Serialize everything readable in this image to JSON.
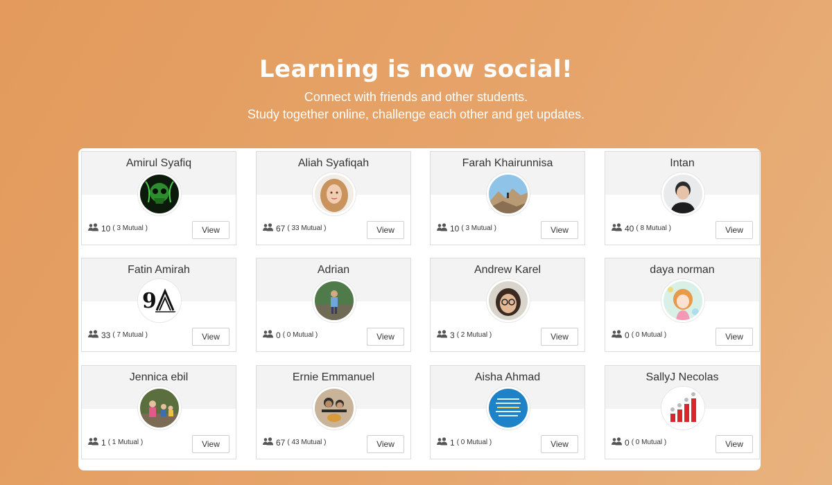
{
  "hero": {
    "title": "Learning is now social!",
    "line1": "Connect with friends and other students.",
    "line2": "Study together online, challenge each other and get updates."
  },
  "view_label": "View",
  "friends": [
    {
      "name": "Amirul Syafiq",
      "count": "10",
      "mutual": "( 3 Mutual )",
      "avatar": "green-skull-avatar"
    },
    {
      "name": "Aliah Syafiqah",
      "count": "67",
      "mutual": "( 33 Mutual )",
      "avatar": "blonde-woman-avatar"
    },
    {
      "name": "Farah Khairunnisa",
      "count": "10",
      "mutual": "( 3 Mutual )",
      "avatar": "rocky-landscape-avatar"
    },
    {
      "name": "Intan",
      "count": "40",
      "mutual": "( 8 Mutual )",
      "avatar": "dark-haired-man-avatar"
    },
    {
      "name": "Fatin Amirah",
      "count": "33",
      "mutual": "( 7 Mutual )",
      "avatar": "9a-logo-avatar"
    },
    {
      "name": "Adrian",
      "count": "0",
      "mutual": "( 0 Mutual )",
      "avatar": "outdoor-person-avatar"
    },
    {
      "name": "Andrew Karel",
      "count": "3",
      "mutual": "( 2 Mutual )",
      "avatar": "glasses-person-avatar"
    },
    {
      "name": "daya norman",
      "count": "0",
      "mutual": "( 0 Mutual )",
      "avatar": "anime-girl-avatar"
    },
    {
      "name": "Jennica ebil",
      "count": "1",
      "mutual": "( 1 Mutual )",
      "avatar": "family-photo-avatar"
    },
    {
      "name": "Ernie Emmanuel",
      "count": "67",
      "mutual": "( 43 Mutual )",
      "avatar": "family-selfie-avatar"
    },
    {
      "name": "Aisha Ahmad",
      "count": "1",
      "mutual": "( 0 Mutual )",
      "avatar": "blue-quote-avatar"
    },
    {
      "name": "SallyJ Necolas",
      "count": "0",
      "mutual": "( 0 Mutual )",
      "avatar": "red-chart-avatar"
    }
  ]
}
